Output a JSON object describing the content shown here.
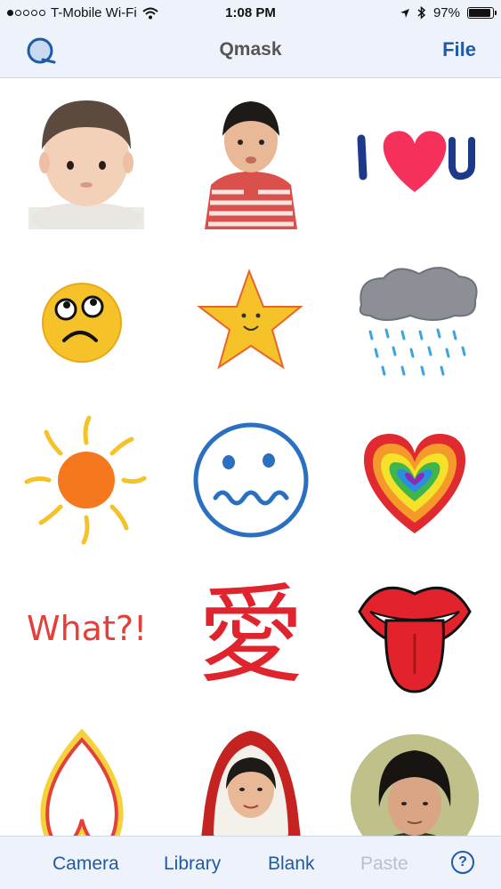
{
  "status": {
    "carrier": "T-Mobile Wi-Fi",
    "time": "1:08 PM",
    "battery": "97%"
  },
  "navbar": {
    "title": "Qmask",
    "file_label": "File",
    "left_icon": "qmask-logo-icon"
  },
  "stickers": [
    {
      "name": "baby-photo",
      "kind": "photo"
    },
    {
      "name": "toddler-photo",
      "kind": "photo"
    },
    {
      "name": "i-heart-u",
      "kind": "drawing",
      "text_i": "I",
      "text_u": "U"
    },
    {
      "name": "rolling-eyes-face",
      "kind": "drawing"
    },
    {
      "name": "smiling-star",
      "kind": "drawing"
    },
    {
      "name": "rain-cloud",
      "kind": "drawing"
    },
    {
      "name": "sun",
      "kind": "drawing"
    },
    {
      "name": "worried-face",
      "kind": "drawing"
    },
    {
      "name": "rainbow-heart",
      "kind": "drawing"
    },
    {
      "name": "what-text",
      "kind": "drawing",
      "text": "What?!"
    },
    {
      "name": "ai-character",
      "kind": "drawing",
      "text": "愛"
    },
    {
      "name": "lips-tongue",
      "kind": "drawing"
    },
    {
      "name": "heart-outline",
      "kind": "drawing"
    },
    {
      "name": "woman-hood-photo",
      "kind": "photo"
    },
    {
      "name": "man-portrait-photo",
      "kind": "photo"
    }
  ],
  "toolbar": {
    "camera_label": "Camera",
    "library_label": "Library",
    "blank_label": "Blank",
    "paste_label": "Paste",
    "help_label": "?"
  },
  "colors": {
    "accent": "#1f5aa8",
    "bar_bg": "#eef3fb",
    "disabled": "#b9c0ca"
  }
}
